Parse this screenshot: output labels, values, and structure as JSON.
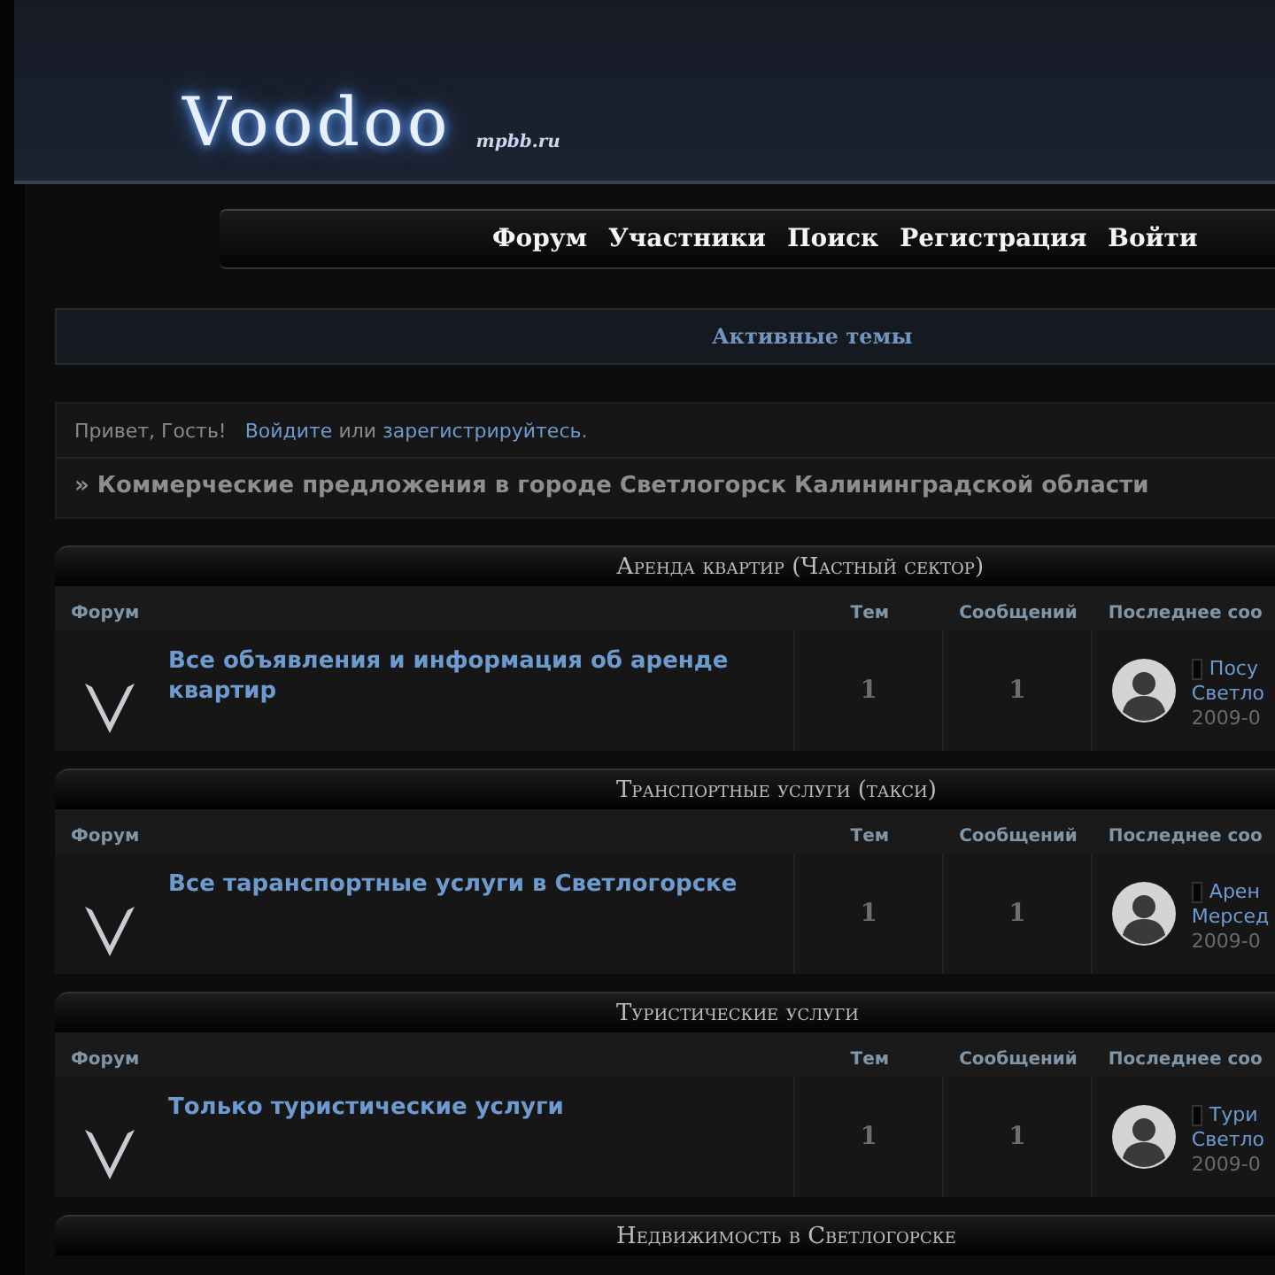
{
  "header": {
    "logo": "Voodoo",
    "logo_subtitle": "mpbb.ru"
  },
  "nav": [
    {
      "label": "Форум"
    },
    {
      "label": "Участники"
    },
    {
      "label": "Поиск"
    },
    {
      "label": "Регистрация"
    },
    {
      "label": "Войти"
    }
  ],
  "active_topics": "Активные темы",
  "greeting": {
    "text": "Привет, Гость!",
    "login_link": "Войдите",
    "or": "или",
    "register_link": "зарегистрируйтесь",
    "end": "."
  },
  "breadcrumb": "» Коммерческие предложения в городе Светлогорск Калининградской области",
  "categories": [
    {
      "title": "Аренда квартир (Частный сектор)",
      "columns": [
        "Форум",
        "Тем",
        "Сообщений",
        "Последнее соо"
      ],
      "forums": [
        {
          "title": "Все объявления и информация об аренде квартир",
          "topics": "1",
          "posts": "1",
          "last_post": {
            "title": "Посу",
            "line2": "Светло",
            "date": "2009-0"
          }
        }
      ]
    },
    {
      "title": "Транспортные услуги (такси)",
      "columns": [
        "Форум",
        "Тем",
        "Сообщений",
        "Последнее соо"
      ],
      "forums": [
        {
          "title": "Все таранспортные услуги в Светлогорске",
          "topics": "1",
          "posts": "1",
          "last_post": {
            "title": "Арен",
            "line2": "Мерсед",
            "date": "2009-0"
          }
        }
      ]
    },
    {
      "title": "Туристические услуги",
      "columns": [
        "Форум",
        "Тем",
        "Сообщений",
        "Последнее соо"
      ],
      "forums": [
        {
          "title": "Только туристические услуги",
          "topics": "1",
          "posts": "1",
          "last_post": {
            "title": "Тури",
            "line2": "Светло",
            "date": "2009-0"
          }
        }
      ]
    },
    {
      "title": "Недвижимость в Светлогорске"
    }
  ]
}
